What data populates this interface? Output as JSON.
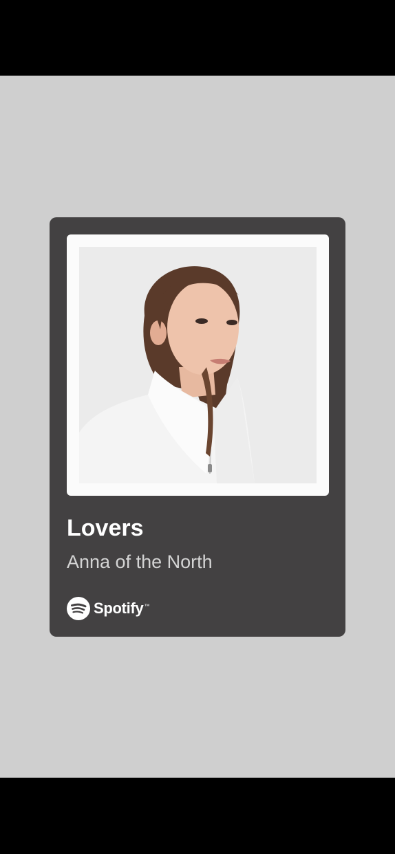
{
  "share_card": {
    "song_title": "Lovers",
    "artist": "Anna of the North",
    "brand": {
      "name": "Spotify",
      "trademark": "™",
      "icon": "spotify-logo-icon"
    },
    "cover_art": {
      "description_icon": "album-cover-image"
    }
  },
  "colors": {
    "background": "#cfcfcf",
    "card": "#434142",
    "frame": "#fbfbfb",
    "title": "#ffffff",
    "artist": "#d4d4d4",
    "system_bars": "#000000"
  }
}
